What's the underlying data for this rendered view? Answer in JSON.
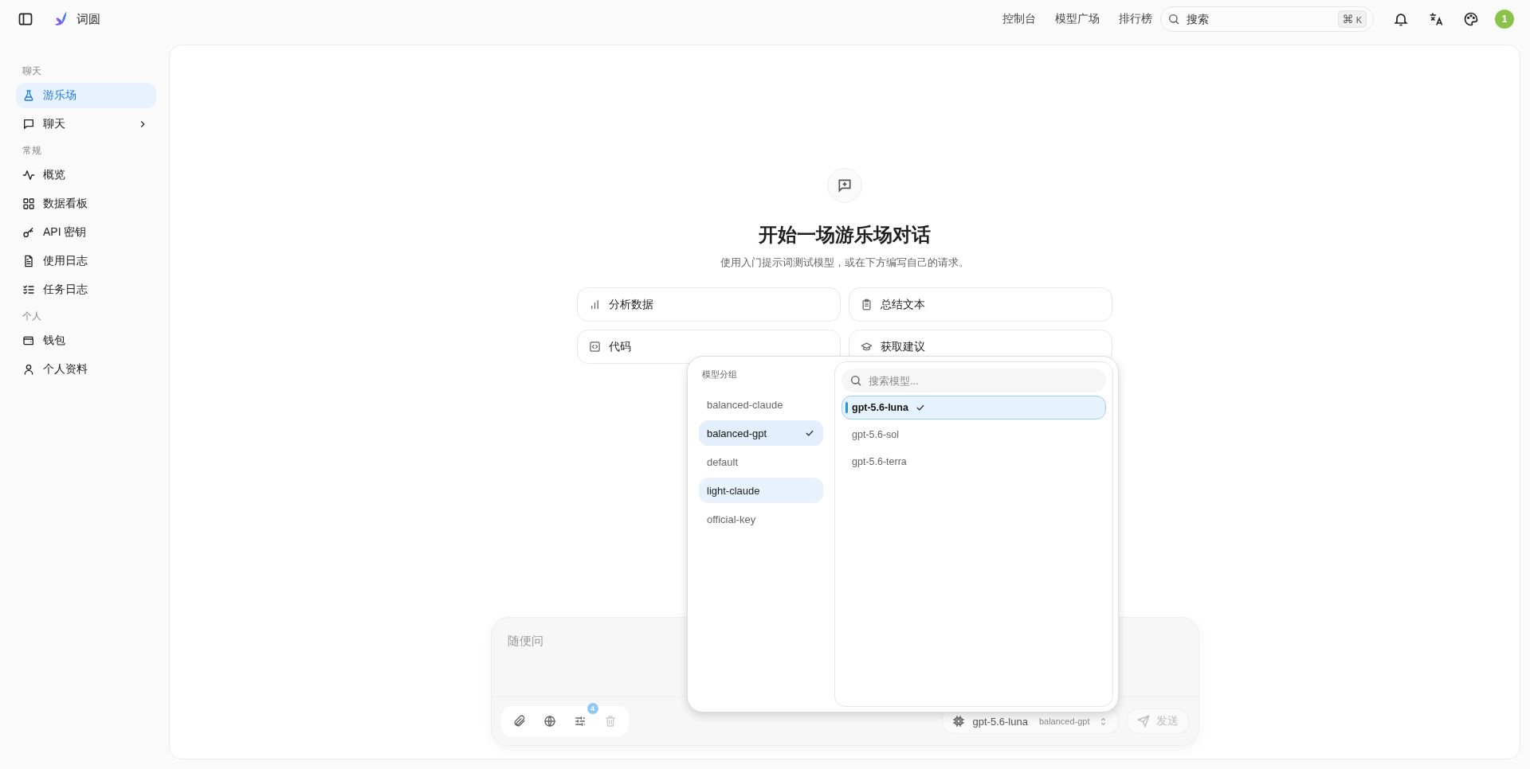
{
  "app": {
    "name": "词圆"
  },
  "top_nav": [
    {
      "label": "控制台"
    },
    {
      "label": "模型广场"
    },
    {
      "label": "排行榜"
    }
  ],
  "search": {
    "placeholder": "搜索",
    "shortcut_symbol": "⌘",
    "shortcut_key": "K"
  },
  "avatar": {
    "label": "1"
  },
  "sidebar": {
    "sections": [
      {
        "title": "聊天",
        "items": [
          {
            "label": "游乐场",
            "selected": true,
            "expandable": false
          },
          {
            "label": "聊天",
            "selected": false,
            "expandable": true
          }
        ]
      },
      {
        "title": "常规",
        "items": [
          {
            "label": "概览",
            "selected": false,
            "expandable": false
          },
          {
            "label": "数据看板",
            "selected": false,
            "expandable": false
          },
          {
            "label": "API 密钥",
            "selected": false,
            "expandable": false
          },
          {
            "label": "使用日志",
            "selected": false,
            "expandable": false
          },
          {
            "label": "任务日志",
            "selected": false,
            "expandable": false
          }
        ]
      },
      {
        "title": "个人",
        "items": [
          {
            "label": "钱包",
            "selected": false,
            "expandable": false
          },
          {
            "label": "个人资料",
            "selected": false,
            "expandable": false
          }
        ]
      }
    ]
  },
  "empty_state": {
    "title": "开始一场游乐场对话",
    "subtitle": "使用入门提示词测试模型，或在下方编写自己的请求。"
  },
  "prompts": [
    {
      "label": "分析数据"
    },
    {
      "label": "总结文本"
    },
    {
      "label": "代码"
    },
    {
      "label": "获取建议"
    }
  ],
  "model_picker": {
    "groups_title": "模型分组",
    "search_placeholder": "搜索模型...",
    "groups": [
      {
        "label": "balanced-claude",
        "selected": false,
        "highlighted": false
      },
      {
        "label": "balanced-gpt",
        "selected": true,
        "highlighted": false
      },
      {
        "label": "default",
        "selected": false,
        "highlighted": false
      },
      {
        "label": "light-claude",
        "selected": false,
        "highlighted": true
      },
      {
        "label": "official-key",
        "selected": false,
        "highlighted": false
      }
    ],
    "models": [
      {
        "label": "gpt-5.6-luna",
        "selected": true
      },
      {
        "label": "gpt-5.6-sol",
        "selected": false
      },
      {
        "label": "gpt-5.6-terra",
        "selected": false
      }
    ]
  },
  "composer": {
    "placeholder": "随便问",
    "tools": [
      {
        "disabled": false
      },
      {
        "disabled": false
      },
      {
        "disabled": false,
        "badge": "4"
      },
      {
        "disabled": true
      }
    ],
    "model": "gpt-5.6-luna",
    "group": "balanced-gpt",
    "send": "发送",
    "send_disabled": true
  }
}
